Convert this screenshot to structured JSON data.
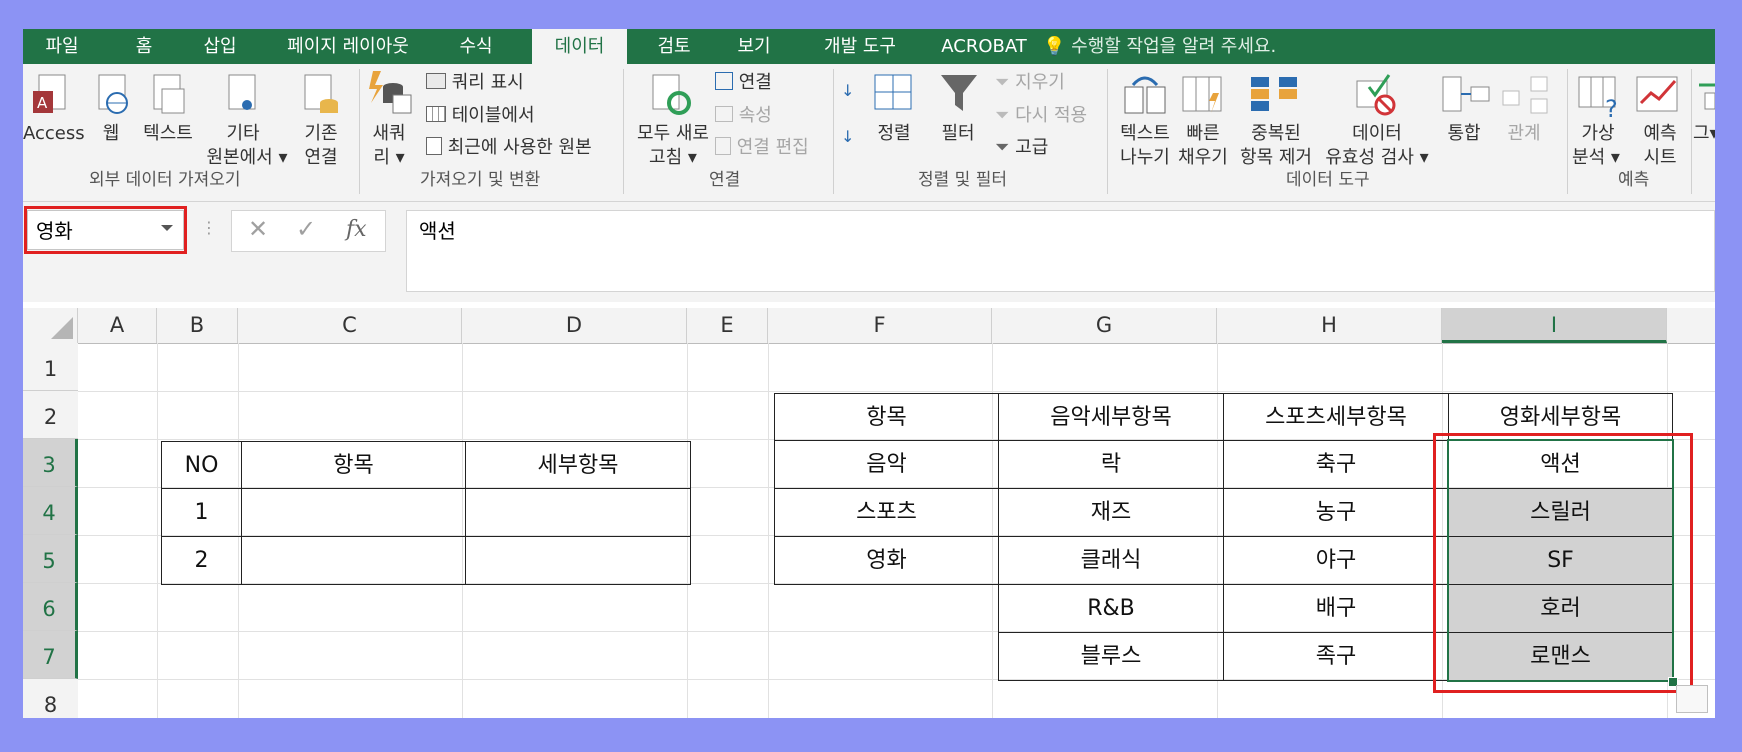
{
  "tabs": [
    "파일",
    "홈",
    "삽입",
    "페이지 레이아웃",
    "수식",
    "데이터",
    "검토",
    "보기",
    "개발 도구",
    "ACROBAT"
  ],
  "active_tab": "데이터",
  "tell_me": "수행할 작업을 알려 주세요.",
  "ribbon": {
    "access": "Access",
    "web": "웹",
    "text": "텍스트",
    "other1": "기타",
    "other2": "원본에서 ▾",
    "existing1": "기존",
    "existing2": "연결",
    "newq1": "새쿼",
    "newq2": "리 ▾",
    "show_queries": "쿼리 표시",
    "from_table": "테이블에서",
    "recent_sources": "최근에 사용한 원본",
    "refresh1": "모두 새로",
    "refresh2": "고침 ▾",
    "connections": "연결",
    "properties": "속성",
    "edit_links": "연결 편집",
    "sort": "정렬",
    "filter": "필터",
    "clear": "지우기",
    "reapply": "다시 적용",
    "advanced": "고급",
    "text_to_cols1": "텍스트",
    "text_to_cols2": "나누기",
    "flash1": "빠른",
    "flash2": "채우기",
    "remove_dup1": "중복된",
    "remove_dup2": "항목 제거",
    "validation1": "데이터",
    "validation2": "유효성 검사 ▾",
    "consolidate": "통합",
    "relationships": "관계",
    "whatif1": "가상",
    "whatif2": "분석 ▾",
    "forecast1": "예측",
    "forecast2": "시트",
    "outline": "그▾",
    "groups": {
      "external": "외부 데이터 가져오기",
      "transform": "가져오기 및 변환",
      "connections": "연결",
      "sortfilter": "정렬 및 필터",
      "datatools": "데이터 도구",
      "forecast": "예측"
    }
  },
  "formula_bar": {
    "name_box": "영화",
    "x": "✕",
    "check": "✓",
    "fx": "fx",
    "value": "액션"
  },
  "columns": [
    "A",
    "B",
    "C",
    "D",
    "E",
    "F",
    "G",
    "H",
    "I"
  ],
  "rows": [
    "1",
    "2",
    "3",
    "4",
    "5",
    "6",
    "7",
    "8"
  ],
  "left_table": {
    "header": [
      "NO",
      "항목",
      "세부항목"
    ],
    "rows": [
      [
        "1",
        "",
        ""
      ],
      [
        "2",
        "",
        ""
      ]
    ]
  },
  "right_table": {
    "header": [
      "항목",
      "음악세부항목",
      "스포츠세부항목",
      "영화세부항목"
    ],
    "items": [
      "음악",
      "스포츠",
      "영화"
    ],
    "music": [
      "락",
      "재즈",
      "클래식",
      "R&B",
      "블루스"
    ],
    "sports": [
      "축구",
      "농구",
      "야구",
      "배구",
      "족구"
    ],
    "movie": [
      "액션",
      "스릴러",
      "SF",
      "호러",
      "로맨스"
    ]
  },
  "colors": {
    "excel_green": "#217346",
    "highlight_red": "#e02020",
    "backdrop": "#8c93f4"
  }
}
